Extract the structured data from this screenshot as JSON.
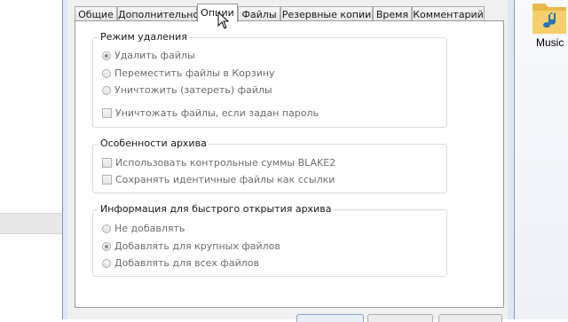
{
  "desktop": {
    "folder_label": "Music"
  },
  "tabs": [
    {
      "label": "Общие",
      "active": false
    },
    {
      "label": "Дополнительно",
      "active": false
    },
    {
      "label": "Опции",
      "active": true
    },
    {
      "label": "Файлы",
      "active": false
    },
    {
      "label": "Резервные копии",
      "active": false
    },
    {
      "label": "Время",
      "active": false
    },
    {
      "label": "Комментарий",
      "active": false
    }
  ],
  "groups": {
    "delete_mode": {
      "title": "Режим удаления",
      "options": [
        {
          "label": "Удалить файлы",
          "checked": true
        },
        {
          "label": "Переместить файлы в Корзину",
          "checked": false
        },
        {
          "label": "Уничтожить (затереть) файлы",
          "checked": false
        }
      ],
      "checkbox": {
        "label": "Уничтожать файлы, если задан пароль",
        "checked": false
      }
    },
    "archive_features": {
      "title": "Особенности архива",
      "checkboxes": [
        {
          "label": "Использовать контрольные суммы BLAKE2",
          "checked": false
        },
        {
          "label": "Сохранять идентичные файлы как ссылки",
          "checked": false
        }
      ]
    },
    "quick_open": {
      "title": "Информация для быстрого открытия архива",
      "options": [
        {
          "label": "Не добавлять",
          "checked": false
        },
        {
          "label": "Добавлять для крупных файлов",
          "checked": true
        },
        {
          "label": "Добавлять для всех файлов",
          "checked": false
        }
      ]
    }
  }
}
